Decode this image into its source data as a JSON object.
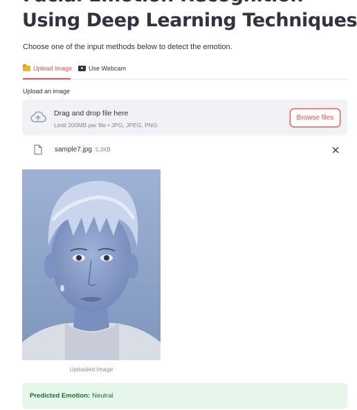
{
  "header": {
    "title_fragment": "Facial Emotion Recognition",
    "title": "Using Deep Learning Techniques",
    "subtitle": "Choose one of the input methods below to detect the emotion."
  },
  "tabs": [
    {
      "label": "Upload Image",
      "icon": "folder-icon",
      "active": true
    },
    {
      "label": "Use Webcam",
      "icon": "webcam-icon",
      "active": false
    }
  ],
  "uploader": {
    "label": "Upload an image",
    "drop_text": "Drag and drop file here",
    "limit_text": "Limit 200MB per file • JPG, JPEG, PNG",
    "browse_label": "Browse files"
  },
  "file": {
    "name": "sample7.jpg",
    "size": "5.2KB"
  },
  "image": {
    "caption": "Uploaded Image"
  },
  "result": {
    "label": "Predicted Emotion:",
    "value": "Neutral"
  },
  "colors": {
    "accent": "#ff4b4b",
    "success_bg": "#e6f6ea",
    "success_text": "#177233",
    "dropzone_bg": "#f0f2f6"
  }
}
